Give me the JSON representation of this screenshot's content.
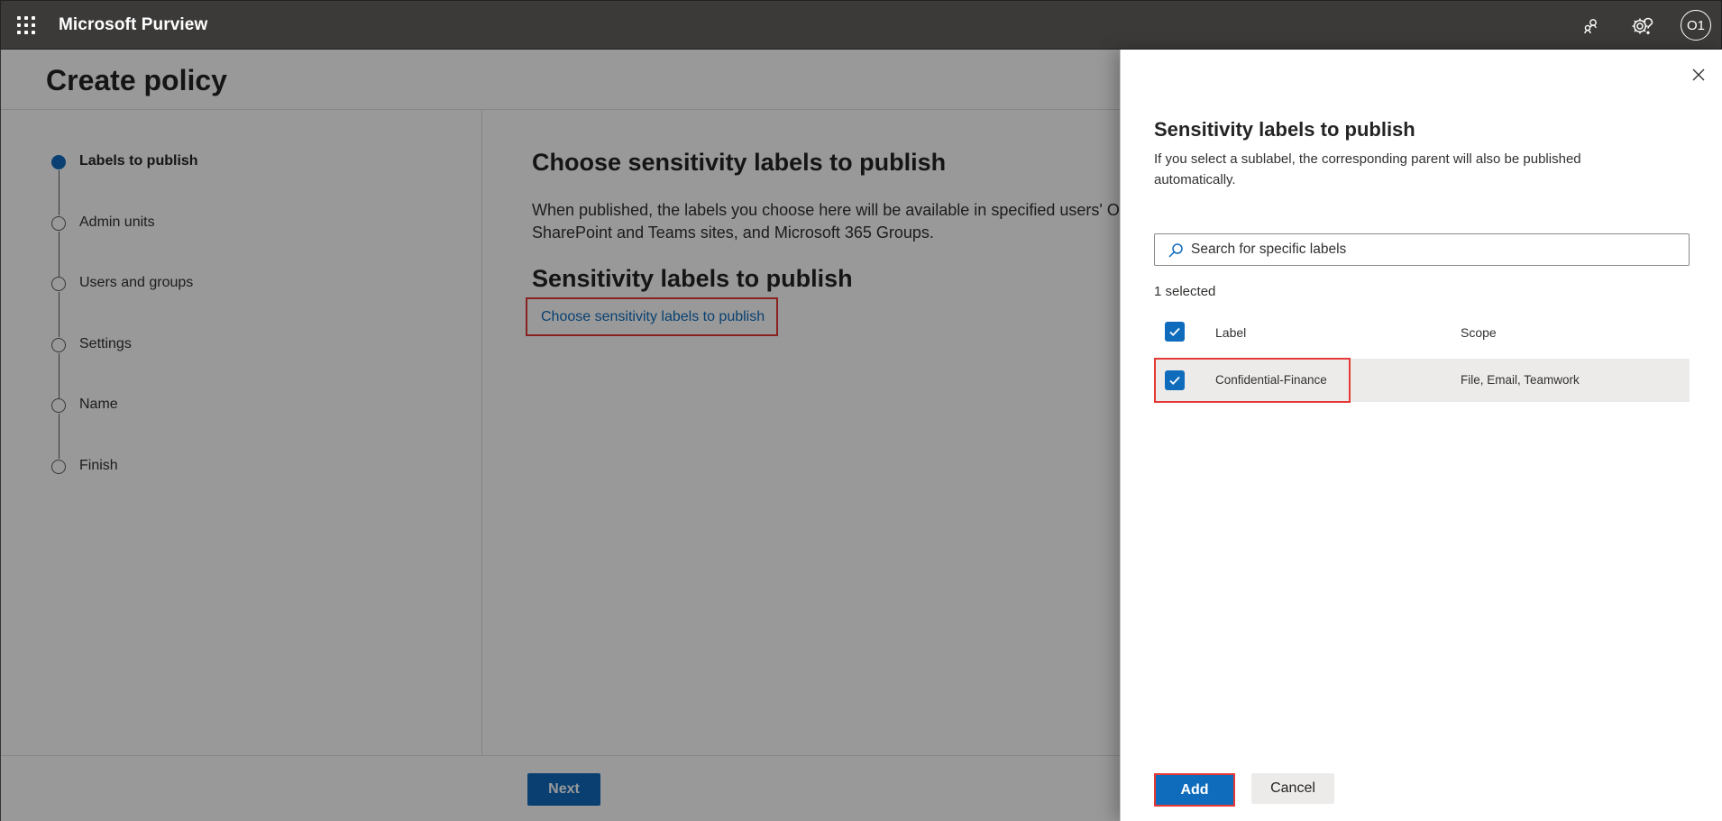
{
  "app": {
    "title": "Microsoft Purview",
    "user_initials": "O1"
  },
  "page": {
    "title": "Create policy"
  },
  "steps": [
    {
      "label": "Labels to publish",
      "active": true
    },
    {
      "label": "Admin units",
      "active": false
    },
    {
      "label": "Users and groups",
      "active": false
    },
    {
      "label": "Settings",
      "active": false
    },
    {
      "label": "Name",
      "active": false
    },
    {
      "label": "Finish",
      "active": false
    }
  ],
  "main": {
    "heading": "Choose sensitivity labels to publish",
    "description": "When published, the labels you choose here will be available in specified users' Off SharePoint and Teams sites, and Microsoft 365 Groups.",
    "subheading": "Sensitivity labels to publish",
    "choose_link": "Choose sensitivity labels to publish",
    "next_label": "Next"
  },
  "panel": {
    "title": "Sensitivity labels to publish",
    "description": "If you select a sublabel, the corresponding parent will also be published automatically.",
    "search_placeholder": "Search for specific labels",
    "selected_count": "1 selected",
    "columns": {
      "label": "Label",
      "scope": "Scope"
    },
    "rows": [
      {
        "label": "Confidential-Finance",
        "scope": "File, Email, Teamwork",
        "checked": true
      }
    ],
    "add_label": "Add",
    "cancel_label": "Cancel"
  },
  "colors": {
    "topbar": "#3b3a39",
    "accent": "#0f6cbd",
    "highlight": "#e53935"
  }
}
